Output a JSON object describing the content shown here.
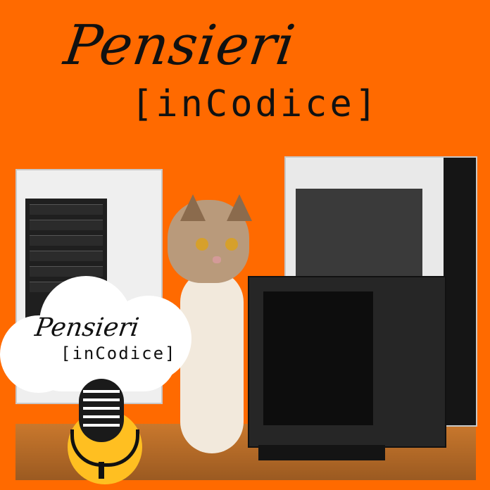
{
  "title": {
    "script": "Pensieri",
    "mono": "[inCodice]"
  },
  "badge": {
    "script": "Pensieri",
    "mono": "[inCodice]"
  },
  "colors": {
    "background": "#ff6a00",
    "cloud": "#ffffff",
    "mic_back": "#ffbf21"
  },
  "icons": {
    "mic": "microphone-icon"
  }
}
